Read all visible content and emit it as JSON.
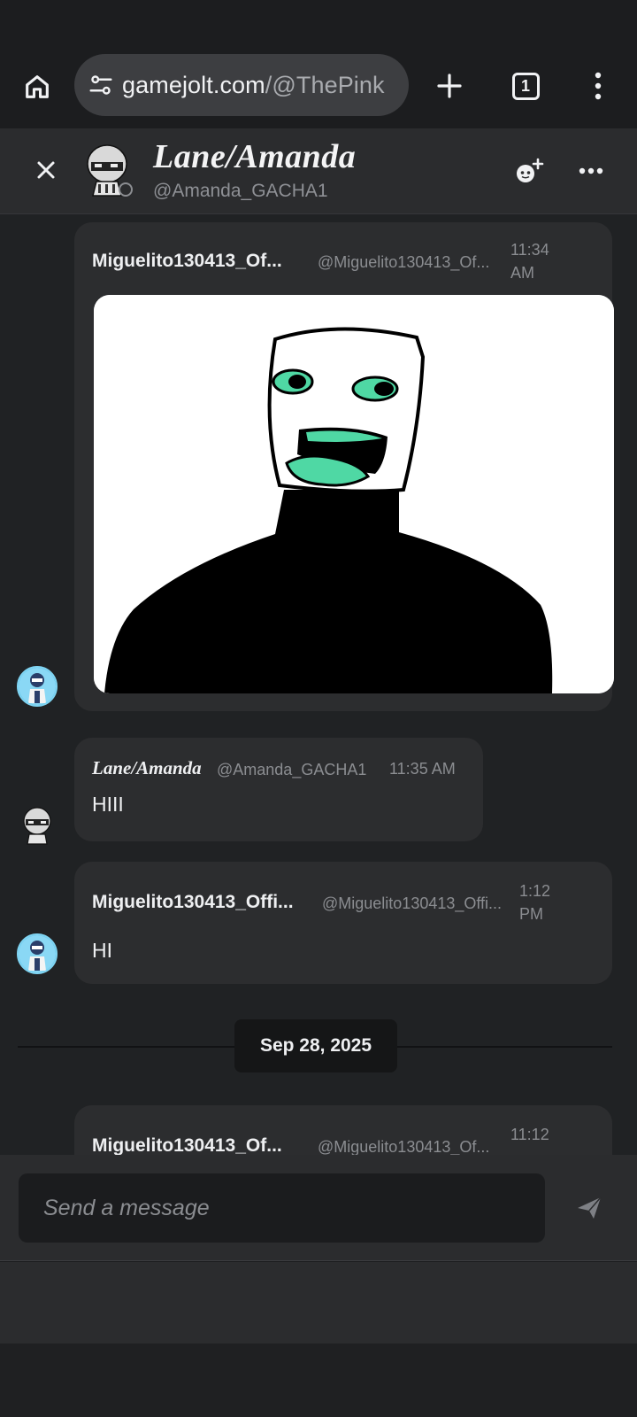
{
  "browser": {
    "url_host": "gamejolt.com",
    "url_path": "/@ThePink",
    "tab_count": "1"
  },
  "chat_header": {
    "name": "Lane/Amanda",
    "handle": "@Amanda_GACHA1"
  },
  "messages": [
    {
      "author": "Miguelito130413_Of...",
      "handle": "@Miguelito130413_Of...",
      "time": "11:34 AM",
      "text": "",
      "has_image": true
    },
    {
      "author": "Lane/Amanda",
      "handle": "@Amanda_GACHA1",
      "time": "11:35 AM",
      "text": "HIII"
    },
    {
      "author": "Miguelito130413_Offi...",
      "handle": "@Miguelito130413_Offi...",
      "time": "1:12 PM",
      "text": "HI"
    },
    {
      "author": "Miguelito130413_Of...",
      "handle": "@Miguelito130413_Of...",
      "time": "11:12",
      "text": ""
    }
  ],
  "date_divider": "Sep 28, 2025",
  "composer": {
    "placeholder": "Send a message"
  },
  "colors": {
    "background": "#202224",
    "card": "#2c2d2f",
    "header": "#2b2c2e",
    "accent_avatar": "#27a7d8",
    "image_mouth": "#4fd8a4"
  },
  "icons": [
    "home-icon",
    "tune-icon",
    "plus-icon",
    "tabs-icon",
    "kebab-menu-icon",
    "close-icon",
    "add-friend-icon",
    "more-horizontal-icon",
    "send-icon"
  ]
}
